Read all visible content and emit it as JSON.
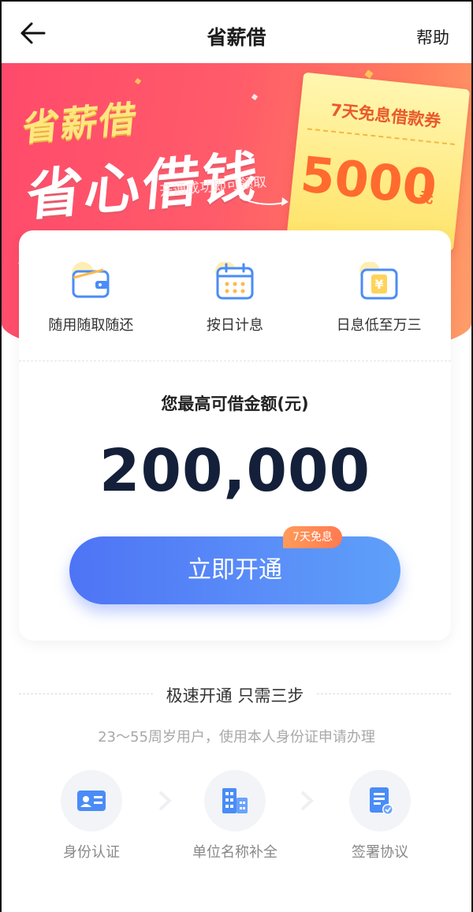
{
  "header": {
    "title": "省薪借",
    "help": "帮助"
  },
  "banner": {
    "slogan_small": "省薪借",
    "slogan_big": "省心借钱",
    "note": "开通成功即可领取",
    "coupon_title": "7天免息借款券",
    "coupon_amount": "5000",
    "coupon_unit": "元"
  },
  "features": [
    {
      "label": "随用随取随还",
      "icon": "wallet-icon"
    },
    {
      "label": "按日计息",
      "icon": "calendar-icon"
    },
    {
      "label": "日息低至万三",
      "icon": "yen-icon"
    }
  ],
  "loan": {
    "amount_label": "您最高可借金额(元)",
    "amount": "200,000",
    "open_button": "立即开通",
    "tag": "7天免息"
  },
  "steps": {
    "title": "极速开通 只需三步",
    "subtitle": "23～55周岁用户，使用本人身份证申请办理",
    "items": [
      {
        "label": "身份认证",
        "icon": "id-card-icon"
      },
      {
        "label": "单位名称补全",
        "icon": "building-icon"
      },
      {
        "label": "签署协议",
        "icon": "document-check-icon"
      }
    ]
  },
  "colors": {
    "banner_start": "#ff4a6b",
    "banner_end": "#ffa06a",
    "button_start": "#4e74f5",
    "button_end": "#5ea0f9",
    "accent_blue": "#4a8cf7",
    "accent_yellow": "#ffd35a"
  }
}
